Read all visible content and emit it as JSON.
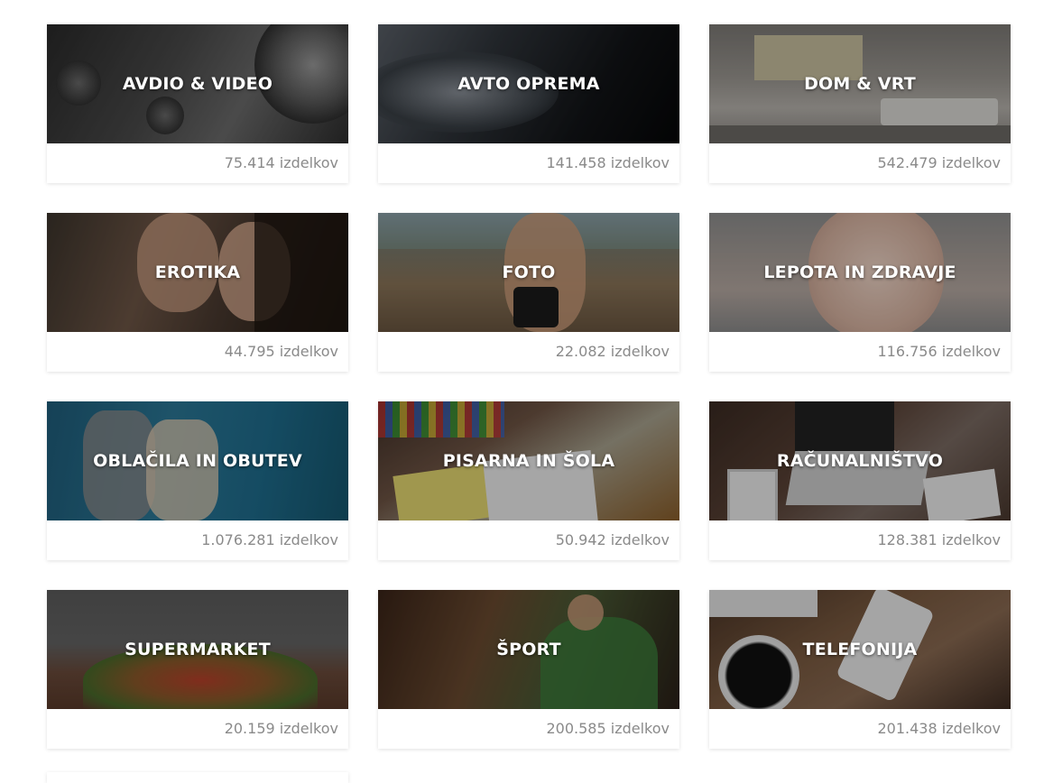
{
  "categories": [
    {
      "title": "AVDIO & VIDEO",
      "count": "75.414 izdelkov",
      "bg": "linear-gradient(120deg,#2a2a2a 0%,#4a4a4a 40%,#6b6b6b 65%,#2e2e2e 100%)"
    },
    {
      "title": "AVTO OPREMA",
      "count": "141.458 izdelkov",
      "bg": "linear-gradient(120deg,#5a6068 0%,#2f343a 35%,#121417 70%,#050607 100%)"
    },
    {
      "title": "DOM & VRT",
      "count": "542.479 izdelkov",
      "bg": "linear-gradient(180deg,#7d7a76 0%,#9c9892 45%,#b7b3ad 70%,#8d8a85 100%)"
    },
    {
      "title": "EROTIKA",
      "count": "44.795 izdelkov",
      "bg": "linear-gradient(110deg,#3c342c 0%,#6e5646 35%,#4a3a30 60%,#20180f 100%)"
    },
    {
      "title": "FOTO",
      "count": "22.082 izdelkov",
      "bg": "linear-gradient(180deg,#5c6a70 0%,#7a7a6c 30%,#8a7458 60%,#6a5640 100%)"
    },
    {
      "title": "LEPOTA IN ZDRAVJE",
      "count": "116.756 izdelkov",
      "bg": "linear-gradient(180deg,#8f8f8f 0%,#a9a09a 40%,#b7aaa3 65%,#8c8c8c 100%)"
    },
    {
      "title": "OBLAČILA IN OBUTEV",
      "count": "1.076.281 izdelkov",
      "bg": "linear-gradient(100deg,#1f5e7c 0%,#2b7897 40%,#1f6d8e 70%,#15576f 100%)"
    },
    {
      "title": "PISARNA IN ŠOLA",
      "count": "50.942 izdelkov",
      "bg": "linear-gradient(150deg,#3e2e26 0%,#6e5444 35%,#a8a28e 60%,#8a5e2a 100%)"
    },
    {
      "title": "RAČUNALNIŠTVO",
      "count": "128.381 izdelkov",
      "bg": "linear-gradient(140deg,#3a2a22 0%,#5a4236 40%,#7a6a62 65%,#4a382e 100%)"
    },
    {
      "title": "SUPERMARKET",
      "count": "20.159 izdelkov",
      "bg": "linear-gradient(180deg,#5c5c5c 0%,#646464 45%,#6a4a3a 70%,#5a3a2a 100%)"
    },
    {
      "title": "ŠPORT",
      "count": "200.585 izdelkov",
      "bg": "linear-gradient(110deg,#3a2418 0%,#6a4a30 35%,#4a5a34 60%,#2a2018 100%)"
    },
    {
      "title": "TELEFONIJA",
      "count": "201.438 izdelkov",
      "bg": "linear-gradient(150deg,#4a3426 0%,#7a5a40 40%,#8a6a52 65%,#3e2c22 100%)"
    }
  ]
}
